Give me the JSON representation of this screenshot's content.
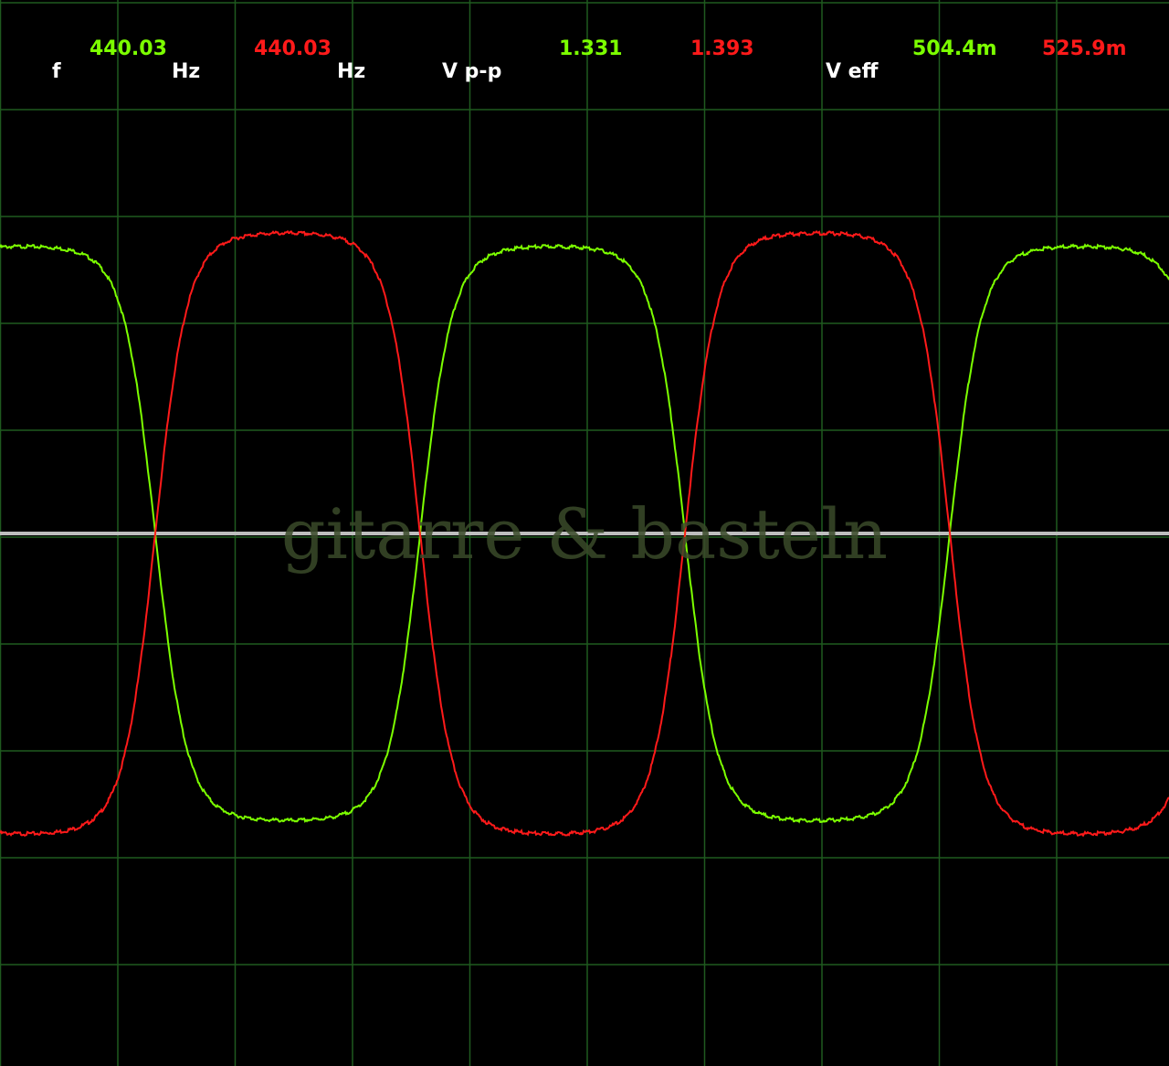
{
  "readouts": {
    "f_label": "f",
    "ch1_freq": "440.03",
    "hz_label_1": "Hz",
    "ch2_freq": "440.03",
    "hz_label_2": "Hz",
    "vpp_label": "V p-p",
    "ch1_vpp": "1.331",
    "ch2_vpp": "1.393",
    "veff_label": "V eff",
    "ch1_veff": "504.4m",
    "ch2_veff": "525.9m"
  },
  "watermark": "gitarre & basteln",
  "colors": {
    "background": "#000000",
    "grid": "#1f5a1f",
    "channel1": "#7cff00",
    "channel2": "#ff1a1a",
    "zero_line": "#bdbdbd",
    "label_text": "#ffffff"
  },
  "chart_data": {
    "type": "line",
    "title": "",
    "xlabel": "",
    "ylabel": "",
    "grid": true,
    "grid_divisions": {
      "x": 10,
      "y": 9
    },
    "series": [
      {
        "channel": 1,
        "color": "#7cff00",
        "frequency_hz": 440.03,
        "vpp": 1.331,
        "veff": "504.4m",
        "phase_deg": 0,
        "shape": "rounded-square"
      },
      {
        "channel": 2,
        "color": "#ff1a1a",
        "frequency_hz": 440.03,
        "vpp": 1.393,
        "veff": "525.9m",
        "phase_deg": 180,
        "shape": "rounded-square"
      }
    ]
  }
}
